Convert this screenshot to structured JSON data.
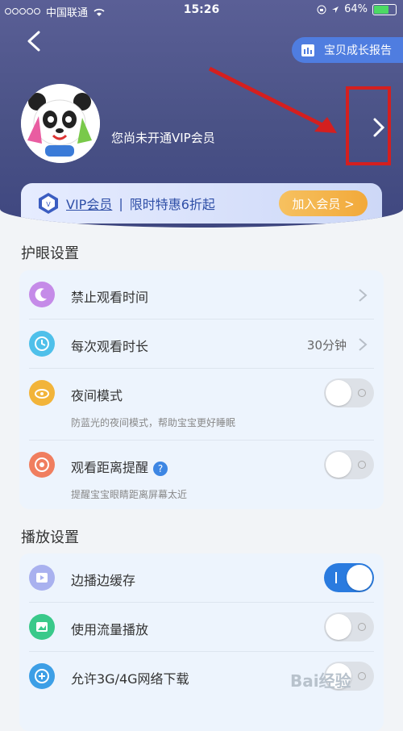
{
  "status_bar": {
    "carrier": "中国联通",
    "time": "15:26",
    "battery": "64%"
  },
  "header": {
    "report_button": "宝贝成长报告",
    "vip_status_text": "您尚未开通VIP会员"
  },
  "vip_banner": {
    "vip_label": "VIP会员",
    "separator": "|",
    "promo": "限时特惠6折起",
    "join_button": "加入会员 >"
  },
  "eye_settings": {
    "title": "护眼设置",
    "items": [
      {
        "label": "禁止观看时间",
        "type": "link",
        "icon_color": "#c58be8"
      },
      {
        "label": "每次观看时长",
        "value": "30分钟",
        "type": "link",
        "icon_color": "#4fc0ea"
      },
      {
        "label": "夜间模式",
        "sub": "防蓝光的夜间模式，帮助宝宝更好睡眠",
        "type": "toggle",
        "on": false,
        "icon_color": "#f2b43a"
      },
      {
        "label": "观看距离提醒",
        "help": "?",
        "sub": "提醒宝宝眼睛距离屏幕太近",
        "type": "toggle",
        "on": false,
        "icon_color": "#f07e5f"
      }
    ]
  },
  "play_settings": {
    "title": "播放设置",
    "items": [
      {
        "label": "边播边缓存",
        "type": "toggle",
        "on": true,
        "icon_color": "#a9b1ef"
      },
      {
        "label": "使用流量播放",
        "type": "toggle",
        "on": false,
        "icon_color": "#39c98a"
      },
      {
        "label": "允许3G/4G网络下载",
        "type": "toggle",
        "on": false,
        "icon_color": "#3d9fe6"
      }
    ]
  },
  "watermark": "Bai经验"
}
